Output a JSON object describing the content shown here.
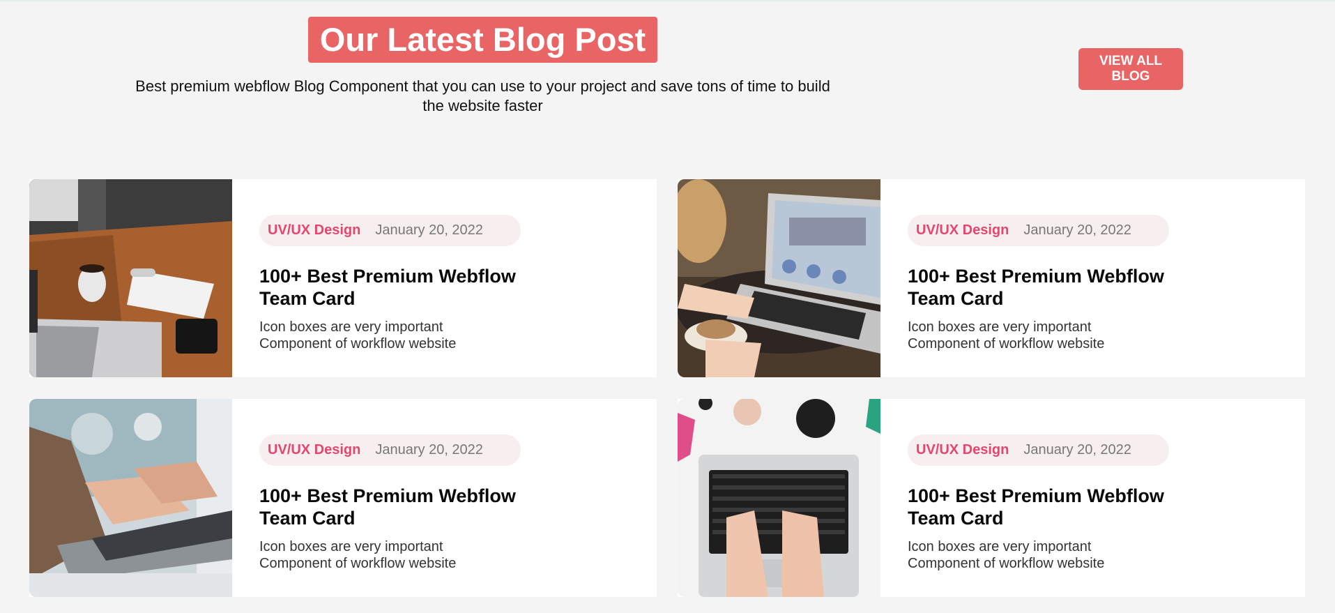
{
  "header": {
    "title": "Our Latest Blog Post",
    "subtitle": "Best premium webflow Blog Component that you can use to your project and save tons of time to build the website faster",
    "view_all_label": "VIEW ALL BLOG"
  },
  "colors": {
    "accent": "#e96565",
    "category": "#e5466e",
    "background": "#f4f4f4"
  },
  "posts": [
    {
      "category": "UV/UX Design",
      "date": "January 20, 2022",
      "title": "100+ Best Premium Webflow Team Card",
      "description": "Icon boxes are very important Component of workflow website",
      "image": "desk-with-laptop-and-mug-photo"
    },
    {
      "category": "UV/UX Design",
      "date": "January 20, 2022",
      "title": "100+ Best Premium Webflow Team Card",
      "description": "Icon boxes are very important Component of workflow website",
      "image": "laptop-with-blog-screen-photo"
    },
    {
      "category": "UV/UX Design",
      "date": "January 20, 2022",
      "title": "100+ Best Premium Webflow Team Card",
      "description": "Icon boxes are very important Component of workflow website",
      "image": "hands-typing-on-laptop-photo"
    },
    {
      "category": "UV/UX Design",
      "date": "January 20, 2022",
      "title": "100+ Best Premium Webflow Team Card",
      "description": "Icon boxes are very important Component of workflow website",
      "image": "top-view-laptop-typing-photo"
    }
  ]
}
